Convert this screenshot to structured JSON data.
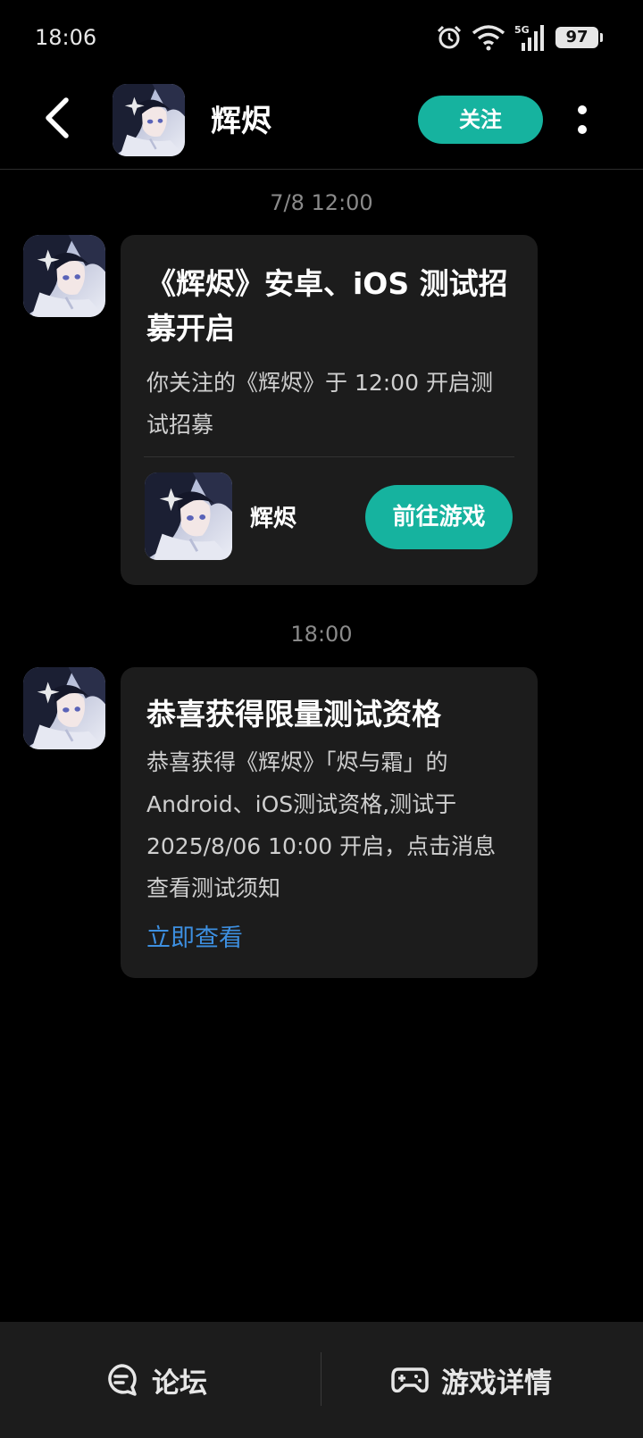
{
  "status_bar": {
    "time": "18:06",
    "network": "5G",
    "battery": "97",
    "icons": [
      "alarm-icon",
      "wifi-icon",
      "signal-icon",
      "battery-icon"
    ]
  },
  "header": {
    "title": "辉烬",
    "follow_label": "关注",
    "back_icon": "chevron-left-icon",
    "more_icon": "more-vertical-icon"
  },
  "messages": [
    {
      "timestamp": "7/8  12:00",
      "title": "《辉烬》安卓、iOS 测试招募开启",
      "body": "你关注的《辉烬》于 12:00 开启测试招募",
      "app_name": "辉烬",
      "action_label": "前往游戏"
    },
    {
      "timestamp": "18:00",
      "title": "恭喜获得限量测试资格",
      "body": "恭喜获得《辉烬》「烬与霜」的Android、iOS测试资格,测试于 2025/8/06 10:00 开启，点击消息查看测试须知",
      "link_label": "立即查看"
    }
  ],
  "bottom_bar": {
    "forum_label": "论坛",
    "details_label": "游戏详情"
  },
  "colors": {
    "background": "#000000",
    "card": "#1c1c1c",
    "accent": "#16b39f",
    "link": "#3d8fe0"
  }
}
